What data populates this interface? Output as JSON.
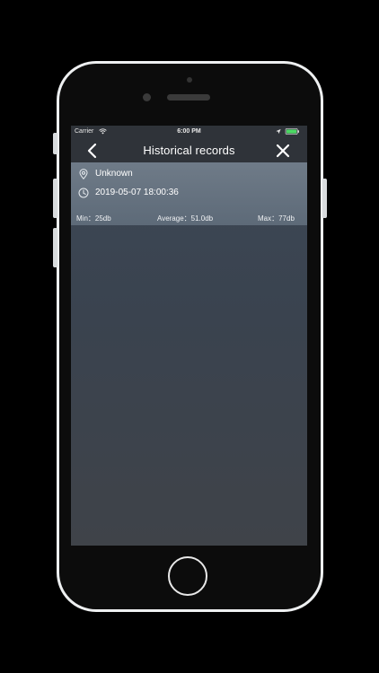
{
  "status_bar": {
    "carrier": "Carrier",
    "time": "6:00 PM",
    "battery_color": "#4cd964"
  },
  "nav": {
    "title": "Historical records"
  },
  "record": {
    "location": "Unknown",
    "timestamp": "2019-05-07 18:00:36"
  },
  "stats": {
    "min": "Min：25db",
    "average": "Average：51.0db",
    "max": "Max：77db"
  },
  "icons": {
    "back": "chevron-left-icon",
    "close": "close-icon",
    "location": "map-pin-icon",
    "time": "clock-icon"
  }
}
